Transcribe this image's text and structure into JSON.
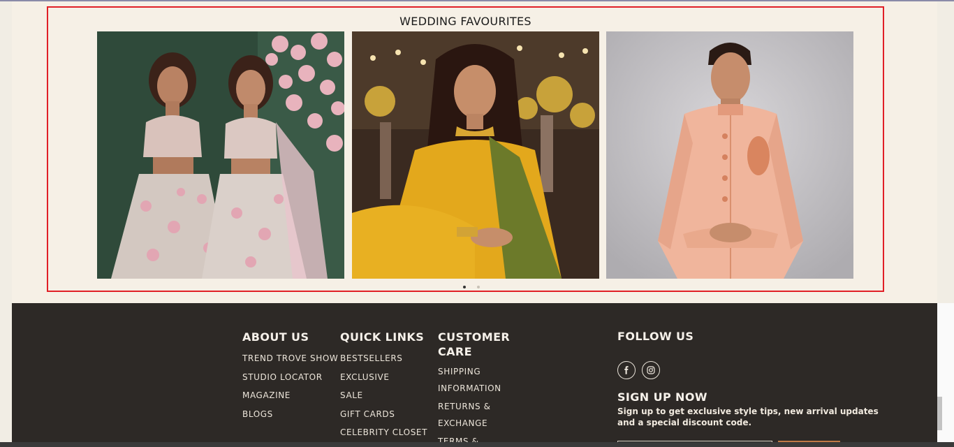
{
  "section": {
    "title": "WEDDING FAVOURITES",
    "cards": [
      {
        "icon": "lehenga-duo-image"
      },
      {
        "icon": "yellow-saree-image"
      },
      {
        "icon": "peach-sherwani-image"
      }
    ],
    "active_dot": 1,
    "dot_count": 2
  },
  "footer": {
    "about": {
      "heading": "ABOUT US",
      "links": [
        "TREND TROVE SHOW",
        "STUDIO LOCATOR",
        "MAGAZINE",
        "BLOGS"
      ]
    },
    "quick": {
      "heading": "QUICK LINKS",
      "links": [
        "BESTSELLERS",
        "EXCLUSIVE",
        "SALE",
        "GIFT CARDS",
        "CELEBRITY CLOSET"
      ]
    },
    "care": {
      "heading": "CUSTOMER CARE",
      "links": [
        "SHIPPING INFORMATION",
        "RETURNS & EXCHANGE",
        "TERMS &"
      ]
    },
    "follow": {
      "heading": "FOLLOW US",
      "socials": [
        "facebook-icon",
        "instagram-icon"
      ]
    },
    "signup": {
      "heading": "SIGN UP NOW",
      "text": "Sign up to get exclusive style tips, new arrival updates and a special discount code."
    }
  },
  "colors": {
    "page_bg": "#f6f0e6",
    "highlight_border": "#e01f26",
    "footer_bg": "#2d2926",
    "accent": "#c07a46"
  }
}
